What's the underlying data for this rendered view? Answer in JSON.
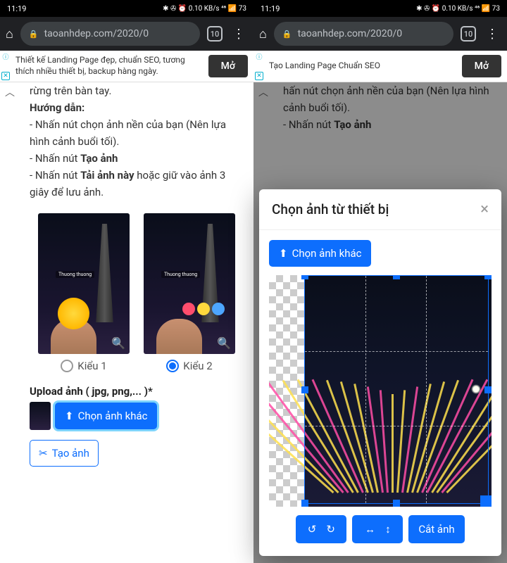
{
  "status": {
    "time": "11:19",
    "icons": "✱ ✇ ⏰ 0.10 KB/s ⁴⁶ 📶 73"
  },
  "browser": {
    "url": "taoanhdep.com/2020/0",
    "tabs": "10"
  },
  "ad1": {
    "text": "Thiết kế Landing Page đẹp, chuẩn SEO, tương thích nhiều thiết bị, backup hàng ngày.",
    "btn": "Mở"
  },
  "ad2": {
    "text": "Tạo Landing Page Chuẩn SEO",
    "btn": "Mở"
  },
  "left": {
    "line0": "rừng trên bàn tay.",
    "hd": "Hướng dẫn:",
    "l1a": "- Nhấn nút chọn ảnh nền của bạn (Nên lựa hình cảnh buổi tối).",
    "l2a": "- Nhấn nút ",
    "l2b": "Tạo ảnh",
    "l3a": "- Nhấn nút ",
    "l3b": "Tải ảnh này",
    "l3c": " hoặc giữ vào ảnh 3 giây để lưu ảnh.",
    "kieu1": "Kiểu 1",
    "kieu2": "Kiểu 2",
    "upload": "Upload ảnh ( jpg, png,... )*",
    "chon": "Chọn ảnh khác",
    "tao": "Tạo ảnh"
  },
  "right": {
    "l1": "hấn nút chọn ảnh nền của bạn (Nên lựa hình cảnh buổi tối).",
    "l2a": "- Nhấn nút ",
    "l2b": "Tạo ảnh"
  },
  "modal": {
    "title": "Chọn ảnh từ thiết bị",
    "chon": "Chọn ảnh khác",
    "cut": "Cắt ảnh"
  }
}
